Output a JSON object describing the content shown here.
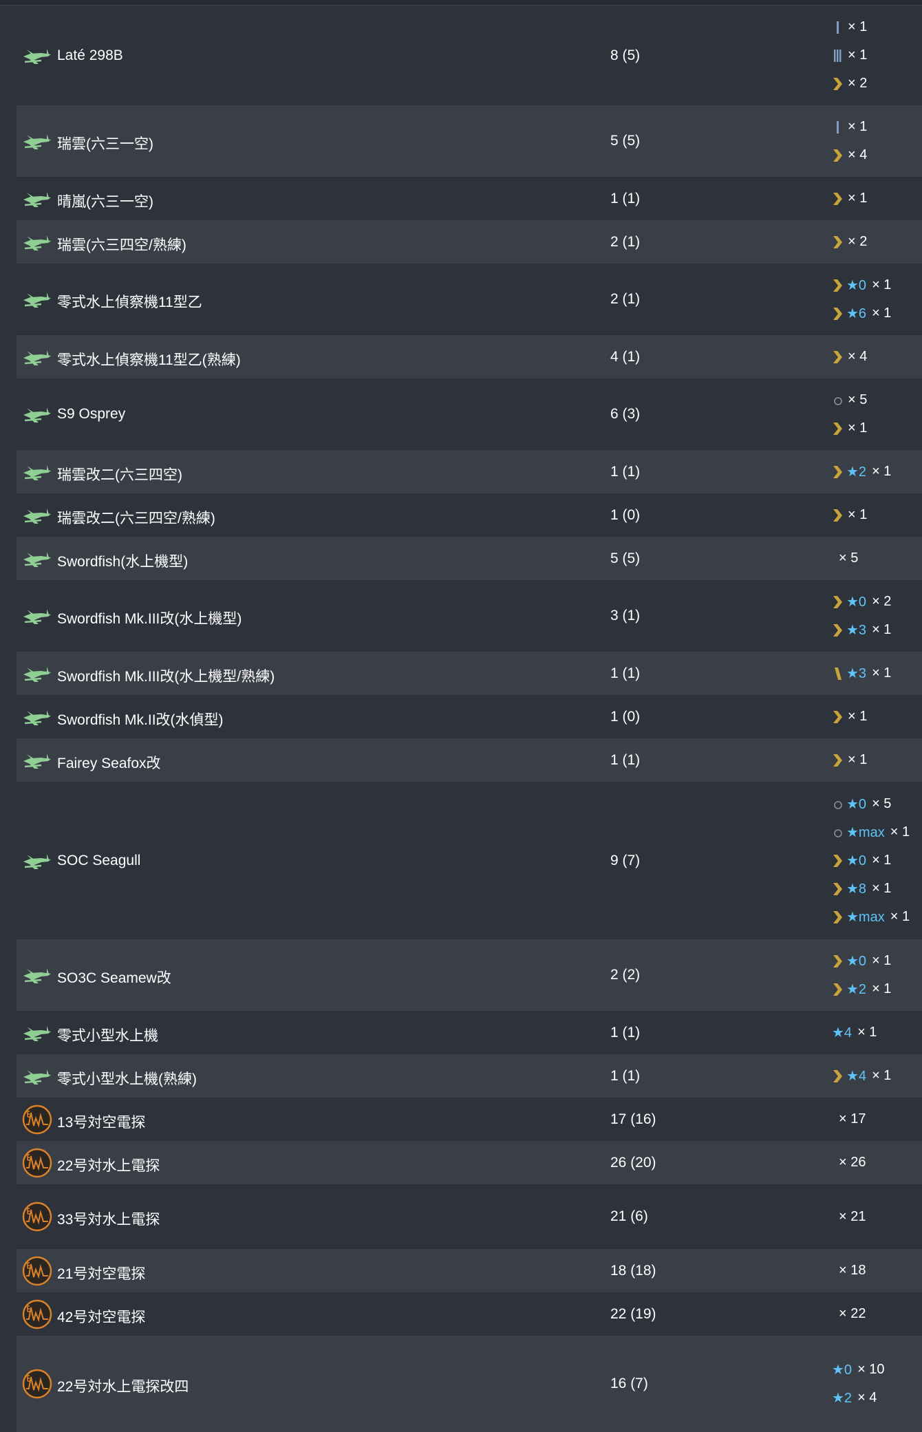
{
  "rows": [
    {
      "icon": "seaplane-icon",
      "name": "Laté 298B",
      "count": "8 (5)",
      "variants": [
        {
          "level": "lvl1",
          "star": "",
          "mult": "× 1"
        },
        {
          "level": "lvl4",
          "star": "",
          "mult": "× 1"
        },
        {
          "level": "chevron",
          "star": "",
          "mult": "× 2"
        }
      ]
    },
    {
      "icon": "seaplane-icon",
      "name": "瑞雲(六三一空)",
      "count": "5 (5)",
      "variants": [
        {
          "level": "lvl1",
          "star": "",
          "mult": "× 1"
        },
        {
          "level": "chevron",
          "star": "",
          "mult": "× 4"
        }
      ]
    },
    {
      "icon": "seaplane-icon",
      "name": "晴嵐(六三一空)",
      "count": "1 (1)",
      "variants": [
        {
          "level": "chevron",
          "star": "",
          "mult": "× 1"
        }
      ]
    },
    {
      "icon": "seaplane-icon",
      "name": "瑞雲(六三四空/熟練)",
      "count": "2 (1)",
      "variants": [
        {
          "level": "chevron",
          "star": "",
          "mult": "× 2"
        }
      ]
    },
    {
      "icon": "seaplane-icon",
      "name": "零式水上偵察機11型乙",
      "count": "2 (1)",
      "variants": [
        {
          "level": "chevron",
          "star": "★0",
          "mult": "× 1"
        },
        {
          "level": "chevron",
          "star": "★6",
          "mult": "× 1"
        }
      ]
    },
    {
      "icon": "seaplane-icon",
      "name": "零式水上偵察機11型乙(熟練)",
      "count": "4 (1)",
      "variants": [
        {
          "level": "chevron",
          "star": "",
          "mult": "× 4"
        }
      ]
    },
    {
      "icon": "seaplane-icon",
      "name": "S9 Osprey",
      "count": "6 (3)",
      "variants": [
        {
          "level": "circle",
          "star": "",
          "mult": "× 5"
        },
        {
          "level": "chevron",
          "star": "",
          "mult": "× 1"
        }
      ]
    },
    {
      "icon": "seaplane-icon",
      "name": "瑞雲改二(六三四空)",
      "count": "1 (1)",
      "variants": [
        {
          "level": "chevron",
          "star": "★2",
          "mult": "× 1"
        }
      ]
    },
    {
      "icon": "seaplane-icon",
      "name": "瑞雲改二(六三四空/熟練)",
      "count": "1 (0)",
      "variants": [
        {
          "level": "chevron",
          "star": "",
          "mult": "× 1"
        }
      ]
    },
    {
      "icon": "seaplane-icon",
      "name": "Swordfish(水上機型)",
      "count": "5 (5)",
      "variants": [
        {
          "level": "none",
          "star": "",
          "mult": "× 5"
        }
      ]
    },
    {
      "icon": "seaplane-icon",
      "name": "Swordfish Mk.III改(水上機型)",
      "count": "3 (1)",
      "variants": [
        {
          "level": "chevron",
          "star": "★0",
          "mult": "× 2"
        },
        {
          "level": "chevron",
          "star": "★3",
          "mult": "× 1"
        }
      ]
    },
    {
      "icon": "seaplane-icon",
      "name": "Swordfish Mk.III改(水上機型/熟練)",
      "count": "1 (1)",
      "variants": [
        {
          "level": "slash",
          "star": "★3",
          "mult": "× 1"
        }
      ]
    },
    {
      "icon": "seaplane-icon",
      "name": "Swordfish Mk.II改(水偵型)",
      "count": "1 (0)",
      "variants": [
        {
          "level": "chevron",
          "star": "",
          "mult": "× 1"
        }
      ]
    },
    {
      "icon": "seaplane-icon",
      "name": "Fairey Seafox改",
      "count": "1 (1)",
      "variants": [
        {
          "level": "chevron",
          "star": "",
          "mult": "× 1"
        }
      ]
    },
    {
      "icon": "seaplane-icon",
      "name": "SOC Seagull",
      "count": "9 (7)",
      "variants": [
        {
          "level": "circle",
          "star": "★0",
          "mult": "× 5"
        },
        {
          "level": "circle",
          "star": "★max",
          "mult": "× 1"
        },
        {
          "level": "chevron",
          "star": "★0",
          "mult": "× 1"
        },
        {
          "level": "chevron",
          "star": "★8",
          "mult": "× 1"
        },
        {
          "level": "chevron",
          "star": "★max",
          "mult": "× 1"
        }
      ]
    },
    {
      "icon": "seaplane-icon",
      "name": "SO3C Seamew改",
      "count": "2 (2)",
      "variants": [
        {
          "level": "chevron",
          "star": "★0",
          "mult": "× 1"
        },
        {
          "level": "chevron",
          "star": "★2",
          "mult": "× 1"
        }
      ]
    },
    {
      "icon": "seaplane-icon",
      "name": "零式小型水上機",
      "count": "1 (1)",
      "variants": [
        {
          "level": "none",
          "star": "★4",
          "mult": "× 1"
        }
      ]
    },
    {
      "icon": "seaplane-icon",
      "name": "零式小型水上機(熟練)",
      "count": "1 (1)",
      "variants": [
        {
          "level": "chevron",
          "star": "★4",
          "mult": "× 1"
        }
      ]
    },
    {
      "icon": "radar-icon",
      "name": "13号対空電探",
      "count": "17 (16)",
      "variants": [
        {
          "level": "none",
          "star": "",
          "mult": "× 17"
        }
      ]
    },
    {
      "icon": "radar-icon",
      "name": "22号対水上電探",
      "count": "26 (20)",
      "variants": [
        {
          "level": "none",
          "star": "",
          "mult": "× 26"
        }
      ]
    },
    {
      "icon": "radar-icon",
      "name": "33号対水上電探",
      "count": "21 (6)",
      "variants": [
        {
          "level": "none",
          "star": "",
          "mult": "× 21"
        }
      ]
    },
    {
      "icon": "radar-icon",
      "name": "21号対空電探",
      "count": "18 (18)",
      "variants": [
        {
          "level": "none",
          "star": "",
          "mult": "× 18"
        }
      ]
    },
    {
      "icon": "radar-icon",
      "name": "42号対空電探",
      "count": "22 (19)",
      "variants": [
        {
          "level": "none",
          "star": "",
          "mult": "× 22"
        }
      ]
    },
    {
      "icon": "radar-icon",
      "name": "22号対水上電探改四",
      "count": "16 (7)",
      "variants": [
        {
          "level": "none",
          "star": "★0",
          "mult": "× 10"
        },
        {
          "level": "none",
          "star": "★2",
          "mult": "× 4"
        }
      ]
    }
  ],
  "colors": {
    "background": "#2e323b",
    "row_alt": "#3a3e47",
    "star": "#5ec4f7",
    "chevron": "#c9a43a",
    "seaplane": "#8fcf94",
    "radar": "#d9822b"
  }
}
